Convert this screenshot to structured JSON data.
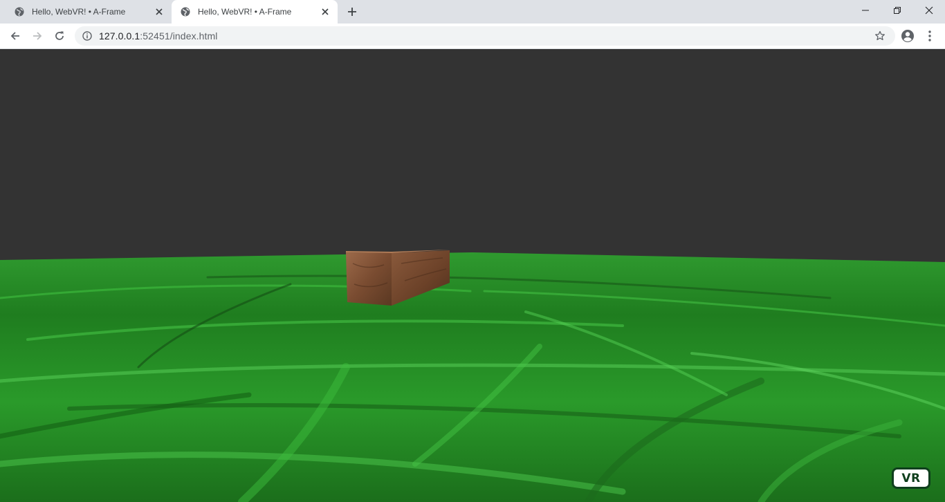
{
  "browser": {
    "tabs": [
      {
        "title": "Hello, WebVR! • A-Frame",
        "active": false
      },
      {
        "title": "Hello, WebVR! • A-Frame",
        "active": true
      }
    ],
    "url": {
      "host": "127.0.0.1",
      "rest": ":52451/index.html"
    }
  },
  "scene": {
    "sky_color": "#333333",
    "ground_color": "#2a8c2a",
    "box_color": "#8a5a3c",
    "vr_button_label": "VR"
  }
}
